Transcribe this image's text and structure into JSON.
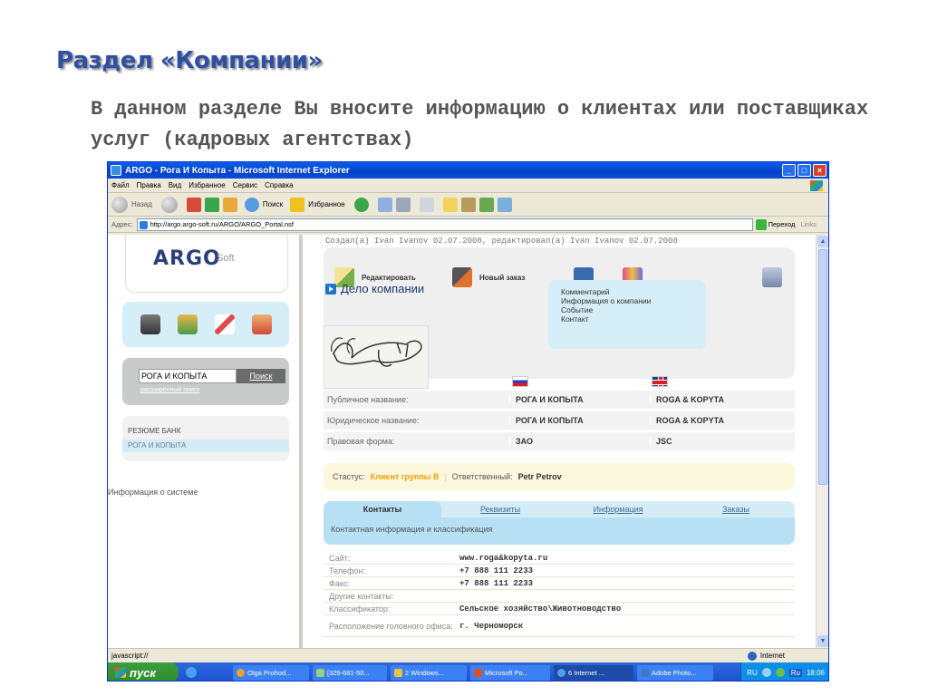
{
  "slide": {
    "title": "Раздел «Компании»",
    "subtitle": "В данном разделе Вы вносите информацию о клиентах или поставщиках услуг (кадровых агентствах)"
  },
  "window": {
    "title": "ARGO - Рога И Копыта - Microsoft Internet Explorer",
    "menu": [
      "Файл",
      "Правка",
      "Вид",
      "Избранное",
      "Сервис",
      "Справка"
    ],
    "toolbar": {
      "back": "Назад",
      "search": "Поиск",
      "favorites": "Избранное"
    },
    "address": {
      "label": "Адрес:",
      "url": "http://argo.argo-soft.ru/ARGO/ARGO_Portal.nsf",
      "go": "Переход",
      "links": "Links"
    },
    "status": {
      "text": "javascript://",
      "zone": "Internet"
    }
  },
  "taskbar": {
    "start": "пуск",
    "items": [
      "Olga Prohod...",
      "[329-681-50...",
      "2 Windows...",
      "Microsoft Po...",
      "6 Internet ...",
      "Adobe Photo..."
    ],
    "lang": "RU",
    "lang2": "Ru",
    "time": "18:06"
  },
  "portal": {
    "logo": "ARGO",
    "logo_soft": "Soft",
    "search": {
      "value": "РОГА И КОПЫТА",
      "button": "Поиск",
      "advanced": "расширенный поиск"
    },
    "bank": {
      "title": "РЕЗЮМЕ БАНК",
      "selected": "РОГА И КОПЫТА"
    },
    "system_info": "Информация о системе",
    "created": "Создал(а) Ivan Ivanov 02.07.2008, редактировал(а) Ivan Ivanov 02.07.2008",
    "actions": {
      "edit": "Редактировать",
      "new_order": "Новый заказ"
    },
    "card_title": "Дело компании",
    "dropdown": [
      "Комментарий",
      "Информация о компании",
      "Событие",
      "Контакт"
    ],
    "info_rows": [
      {
        "label": "Публичное название:",
        "ru": "РОГА И КОПЫТА",
        "en": "ROGA & KOPYTA"
      },
      {
        "label": "Юридическое название:",
        "ru": "РОГА И КОПЫТА",
        "en": "ROGA & KOPYTA"
      },
      {
        "label": "Правовая форма:",
        "ru": "ЗАО",
        "en": "JSC"
      }
    ],
    "status": {
      "label": "Стастус:",
      "value": "Клиент группы В",
      "resp_label": "Ответственный:",
      "resp_value": "Petr Petrov"
    },
    "tabs": [
      "Контакты",
      "Реквизиты",
      "Информация",
      "Заказы"
    ],
    "tabs_desc": "Контактная информация и классификация",
    "contacts": [
      {
        "label": "Сайт:",
        "value": "www.roga&kopyta.ru"
      },
      {
        "label": "Телефон:",
        "value": "+7 888 111 2233"
      },
      {
        "label": "Факс:",
        "value": "+7 888 111 2233"
      },
      {
        "label": "Другие контакты:",
        "value": ""
      },
      {
        "label": "Классификатор:",
        "value": "Сельское хозяйство\\Животноводство"
      },
      {
        "label": "Расположение головного офиса:",
        "value": "г. Черноморск"
      }
    ]
  },
  "colors": {
    "title_blue": "#2E4FA3",
    "panel_blue": "#D6EEF7",
    "tab_blue": "#B8E0F5",
    "status_yellow": "#FCF8DD",
    "client_orange": "#F0A000"
  }
}
